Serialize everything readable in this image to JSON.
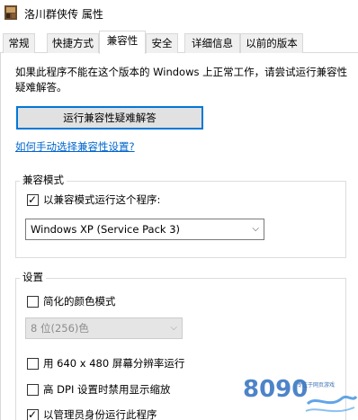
{
  "window": {
    "title": "洛川群侠传 属性",
    "icon": "app-icon"
  },
  "tabs": [
    {
      "label": "常规",
      "active": false
    },
    {
      "label": "快捷方式",
      "active": false
    },
    {
      "label": "兼容性",
      "active": true
    },
    {
      "label": "安全",
      "active": false
    },
    {
      "label": "详细信息",
      "active": false
    },
    {
      "label": "以前的版本",
      "active": false
    }
  ],
  "compat": {
    "intro": "如果此程序不能在这个版本的 Windows 上正常工作，请尝试运行兼容性疑难解答。",
    "troubleshoot_button": "运行兼容性疑难解答",
    "manual_link": "如何手动选择兼容性设置?",
    "mode_group": {
      "label": "兼容模式",
      "checkbox_label": "以兼容模式运行这个程序:",
      "checked": true,
      "selected_os": "Windows XP (Service Pack 3)"
    },
    "settings_group": {
      "label": "设置",
      "reduced_color_label": "简化的颜色模式",
      "reduced_color_checked": false,
      "color_depth_value": "8 位(256)色",
      "res_640_label": "用 640 x 480 屏幕分辨率运行",
      "res_640_checked": false,
      "high_dpi_label": "高 DPI 设置时禁用显示缩放",
      "high_dpi_checked": false,
      "run_as_admin_label": "以管理员身份运行此程序",
      "run_as_admin_checked": true
    }
  },
  "watermark": {
    "brand": "8090",
    "tagline": "专注于网页游戏"
  },
  "colors": {
    "accent": "#0078d7",
    "link": "#0066cc",
    "border": "#d9d9d9"
  }
}
